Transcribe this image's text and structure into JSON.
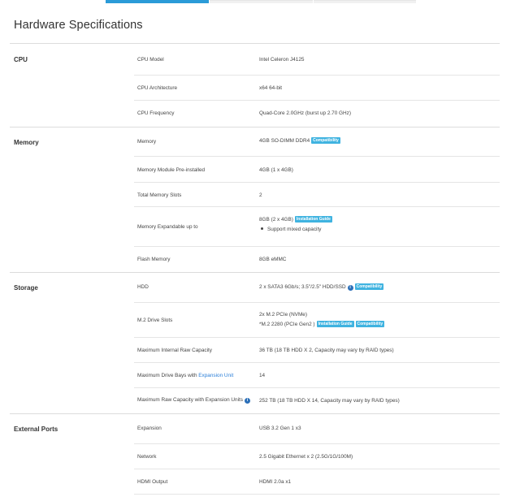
{
  "page_title": "Hardware Specifications",
  "sections": {
    "cpu": {
      "title": "CPU",
      "rows": [
        {
          "label": "CPU Model",
          "value": "Intel Celeron J4125"
        },
        {
          "label": "CPU Architecture",
          "value": "x64 64-bit"
        },
        {
          "label": "CPU Frequency",
          "value": "Quad-Core 2.0GHz (burst up 2.70 GHz)"
        }
      ]
    },
    "memory": {
      "title": "Memory",
      "rows": [
        {
          "label": "Memory",
          "value": "4GB SO-DIMM DDR4",
          "badge": "Compatibility"
        },
        {
          "label": "Memory Module Pre-installed",
          "value": "4GB (1 x 4GB)"
        },
        {
          "label": "Total Memory Slots",
          "value": "2"
        },
        {
          "label": "Memory Expandable up to",
          "value": "8GB (2 x 4GB)",
          "badge": "Installation Guide",
          "bullet": "Support mixed capacity"
        },
        {
          "label": "Flash Memory",
          "value": "8GB eMMC"
        }
      ]
    },
    "storage": {
      "title": "Storage",
      "rows": [
        {
          "label": "HDD",
          "value": "2 x SATA3 6Gb/s; 3.5\"/2.5\" HDD/SSD",
          "badge": "Compatibility"
        },
        {
          "label": "M.2 Drive Slots",
          "value_line1": "2x M.2 PCIe (NVMe)",
          "value_line2": "*M.2 2280 (PCIe Gen2 )",
          "badge1": "Installation Guide",
          "badge2": "Compatibility"
        },
        {
          "label": "Maximum Internal Raw Capacity",
          "value": "36 TB  (18 TB HDD X 2, Capacity may vary by RAID types)"
        },
        {
          "label_prefix": "Maximum Drive Bays with ",
          "label_link": "Expansion Unit",
          "value": "14"
        },
        {
          "label": "Maximum Raw Capacity with Expansion Units",
          "value": "252 TB  (18 TB HDD X 14, Capacity may vary by RAID types)"
        }
      ]
    },
    "external_ports": {
      "title": "External Ports",
      "rows": [
        {
          "label": "Expansion",
          "value": "USB 3.2 Gen 1 x3"
        },
        {
          "label": "Network",
          "value": "2.5 Gigabit Ethernet x 2 (2.5G/1G/100M)"
        },
        {
          "label": "HDMI Output",
          "value": "HDMI 2.0a x1"
        }
      ]
    }
  },
  "icons": {
    "info": "info-icon"
  },
  "colors": {
    "accent": "#2b9bd8",
    "badge": "#3fb3e0",
    "link": "#2b7fd8"
  }
}
